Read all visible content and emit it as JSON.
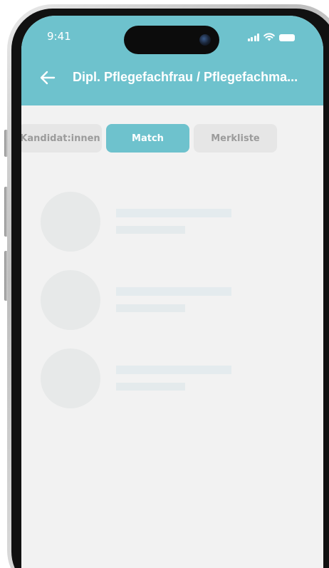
{
  "status_bar": {
    "time": "9:41"
  },
  "header": {
    "title": "Dipl. Pflegefachfrau / Pflegefachma...",
    "back_icon": "arrow-left-icon"
  },
  "tabs": [
    {
      "label": "Kandidat:innen",
      "active": false
    },
    {
      "label": "Match",
      "active": true
    },
    {
      "label": "Merkliste",
      "active": false
    }
  ],
  "colors": {
    "accent": "#6ec2cd",
    "background": "#f2f2f2",
    "tab_inactive": "#e6e6e6",
    "skeleton": "#e7e9e9"
  },
  "loading_placeholders": 3
}
